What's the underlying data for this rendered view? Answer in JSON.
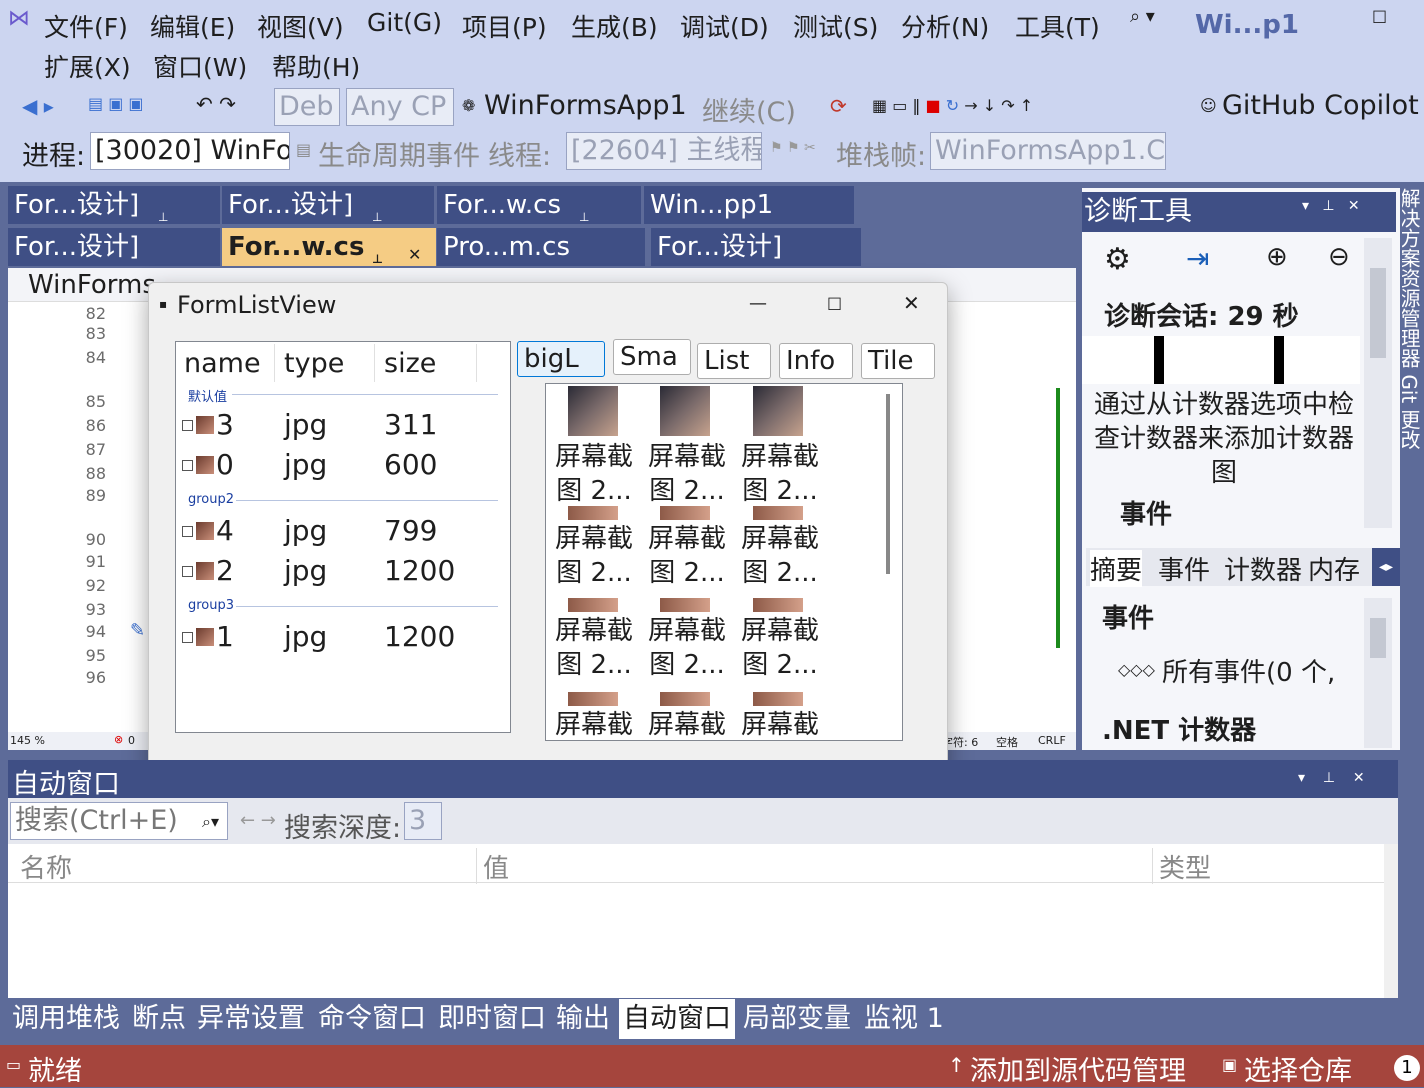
{
  "menu": {
    "items": [
      "文件(F)",
      "编辑(E)",
      "视图(V)",
      "Git(G)",
      "项目(P)",
      "生成(B)",
      "调试(D)",
      "测试(S)",
      "分析(N)",
      "工具(T)"
    ],
    "items2": [
      "扩展(X)",
      "窗口(W)",
      "帮助(H)"
    ],
    "title": "Wi...p1"
  },
  "toolbar": {
    "config": "Deb",
    "platform": "Any CP",
    "project": "WinFormsApp1",
    "continue": "继续(C)",
    "copilot": "GitHub Copilot"
  },
  "debugbar": {
    "process_label": "进程:",
    "process_value": "[30020] WinFo",
    "lifecycle": "生命周期事件",
    "thread_label": "线程:",
    "thread_value": "[22604] 主线程",
    "stack_label": "堆栈帧:",
    "stack_value": "WinFormsApp1.C"
  },
  "doc_tabs": {
    "row1": [
      "For...设计]",
      "For...设计]",
      "For...w.cs",
      "Win...pp1"
    ],
    "row2": [
      "For...设计]",
      "For...w.cs",
      "Pro...m.cs",
      "For...设计]"
    ]
  },
  "editor": {
    "nav_left": "WinForms",
    "line_numbers": [
      "82",
      "83",
      "84",
      "85",
      "86",
      "87",
      "88",
      "89",
      "90",
      "91",
      "92",
      "93",
      "94",
      "95",
      "96"
    ],
    "zoom": "145 %",
    "errors": "0",
    "col_info": "字符: 6",
    "indent": "空格",
    "eol": "CRLF"
  },
  "form": {
    "title": "FormListView",
    "columns": [
      "name",
      "type",
      "size"
    ],
    "groups": [
      {
        "name": "默认值",
        "rows": [
          {
            "name": "3",
            "type": "jpg",
            "size": "311"
          },
          {
            "name": "0",
            "type": "jpg",
            "size": "600"
          }
        ]
      },
      {
        "name": "group2",
        "rows": [
          {
            "name": "4",
            "type": "jpg",
            "size": "799"
          },
          {
            "name": "2",
            "type": "jpg",
            "size": "1200"
          }
        ]
      },
      {
        "name": "group3",
        "rows": [
          {
            "name": "1",
            "type": "jpg",
            "size": "1200"
          }
        ]
      }
    ],
    "view_buttons": [
      "bigL",
      "Sma",
      "List",
      "Info",
      "Tile"
    ],
    "tile_caption_1": "屏幕截",
    "tile_caption_2": "图 2...",
    "tile_caption_partial": "屏幕截"
  },
  "diag": {
    "title": "诊断工具",
    "session": "诊断会话: 29 秒",
    "hint": "通过从计数器选项中检查计数器来添加计数器图",
    "events_header": "事件",
    "tabs": [
      "摘要",
      "事件",
      "计数器",
      "内存"
    ],
    "events_section": "事件",
    "all_events": "所有事件(0 个,",
    "net_counters": ".NET 计数器"
  },
  "side_strip": {
    "text": "解决方案资源管理器 Git 更改"
  },
  "autos": {
    "title": "自动窗口",
    "search_placeholder": "搜索(Ctrl+E)",
    "depth_label": "搜索深度:",
    "depth_value": "3",
    "col_name": "名称",
    "col_value": "值",
    "col_type": "类型"
  },
  "bottom_tabs": [
    "调用堆栈",
    "断点",
    "异常设置",
    "命令窗口",
    "即时窗口",
    "输出",
    "自动窗口",
    "局部变量",
    "监视 1"
  ],
  "status": {
    "ready": "就绪",
    "source_control": "添加到源代码管理",
    "repo": "选择仓库",
    "notif": "1"
  },
  "colors": {
    "accent": "#5d6b99",
    "tab_active": "#f5cc84",
    "status": "#a5453d"
  }
}
